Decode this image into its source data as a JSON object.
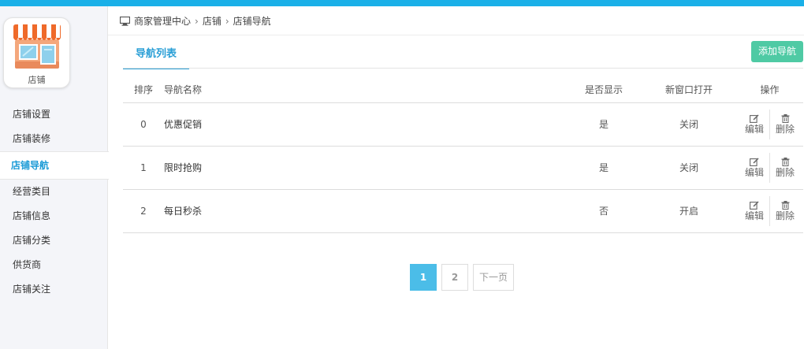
{
  "colors": {
    "accent": "#1ab0e8",
    "add_button": "#4fcaa4",
    "active_page": "#4bbde8"
  },
  "store": {
    "label": "店铺",
    "icon": "shop-awning-icon"
  },
  "sidebar": {
    "items": [
      {
        "label": "店铺设置",
        "active": false
      },
      {
        "label": "店铺装修",
        "active": false
      },
      {
        "label": "店铺导航",
        "active": true
      },
      {
        "label": "经营类目",
        "active": false
      },
      {
        "label": "店铺信息",
        "active": false
      },
      {
        "label": "店铺分类",
        "active": false
      },
      {
        "label": "供货商",
        "active": false
      },
      {
        "label": "店铺关注",
        "active": false
      }
    ]
  },
  "breadcrumb": {
    "icon": "monitor-icon",
    "items": [
      "商家管理中心",
      "店铺",
      "店铺导航"
    ],
    "separator": "›"
  },
  "tabs": {
    "active_label": "导航列表"
  },
  "add_button": "添加导航",
  "table": {
    "headers": {
      "order": "排序",
      "name": "导航名称",
      "show": "是否显示",
      "new_window": "新窗口打开",
      "ops": "操作"
    },
    "rows": [
      {
        "order": "0",
        "name": "优惠促销",
        "show": "是",
        "new_window": "关闭"
      },
      {
        "order": "1",
        "name": "限时抢购",
        "show": "是",
        "new_window": "关闭"
      },
      {
        "order": "2",
        "name": "每日秒杀",
        "show": "否",
        "new_window": "开启"
      }
    ],
    "edit_label": "编辑",
    "delete_label": "删除"
  },
  "pagination": {
    "pages": [
      "1",
      "2"
    ],
    "current": "1",
    "next_label": "下一页"
  }
}
